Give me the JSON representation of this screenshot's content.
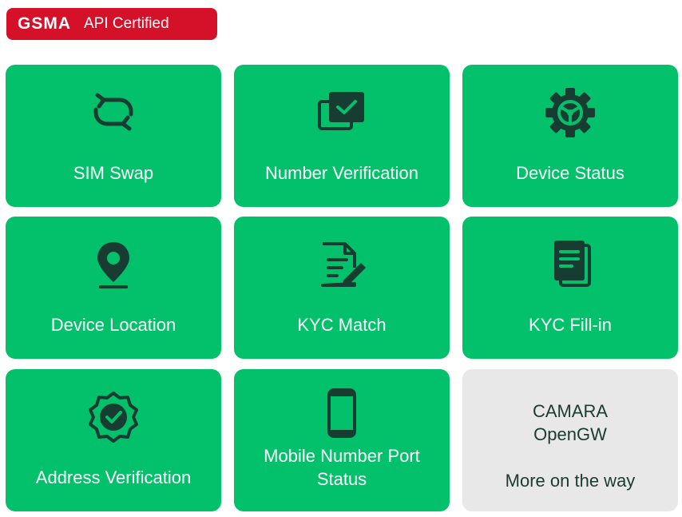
{
  "badge": {
    "brand": "GSMA",
    "suffix": "API Certified"
  },
  "tiles": [
    {
      "label": "SIM Swap",
      "icon": "sim-swap-icon"
    },
    {
      "label": "Number Verification",
      "icon": "number-verification-icon"
    },
    {
      "label": "Device Status",
      "icon": "gear-icon"
    },
    {
      "label": "Device Location",
      "icon": "location-pin-icon"
    },
    {
      "label": "KYC Match",
      "icon": "document-edit-icon"
    },
    {
      "label": "KYC Fill-in",
      "icon": "documents-icon"
    },
    {
      "label": "Address Verification",
      "icon": "verified-badge-icon"
    },
    {
      "label1": "Mobile Number Port",
      "label2": "Status",
      "icon": "mobile-phone-icon"
    }
  ],
  "more": {
    "line1": "CAMARA",
    "line2": "OpenGW",
    "line3": "More on the way"
  },
  "colors": {
    "tile": "#03c06b",
    "icon": "#173d33",
    "badge": "#d5112a",
    "gray_tile": "#e8e8e8"
  }
}
